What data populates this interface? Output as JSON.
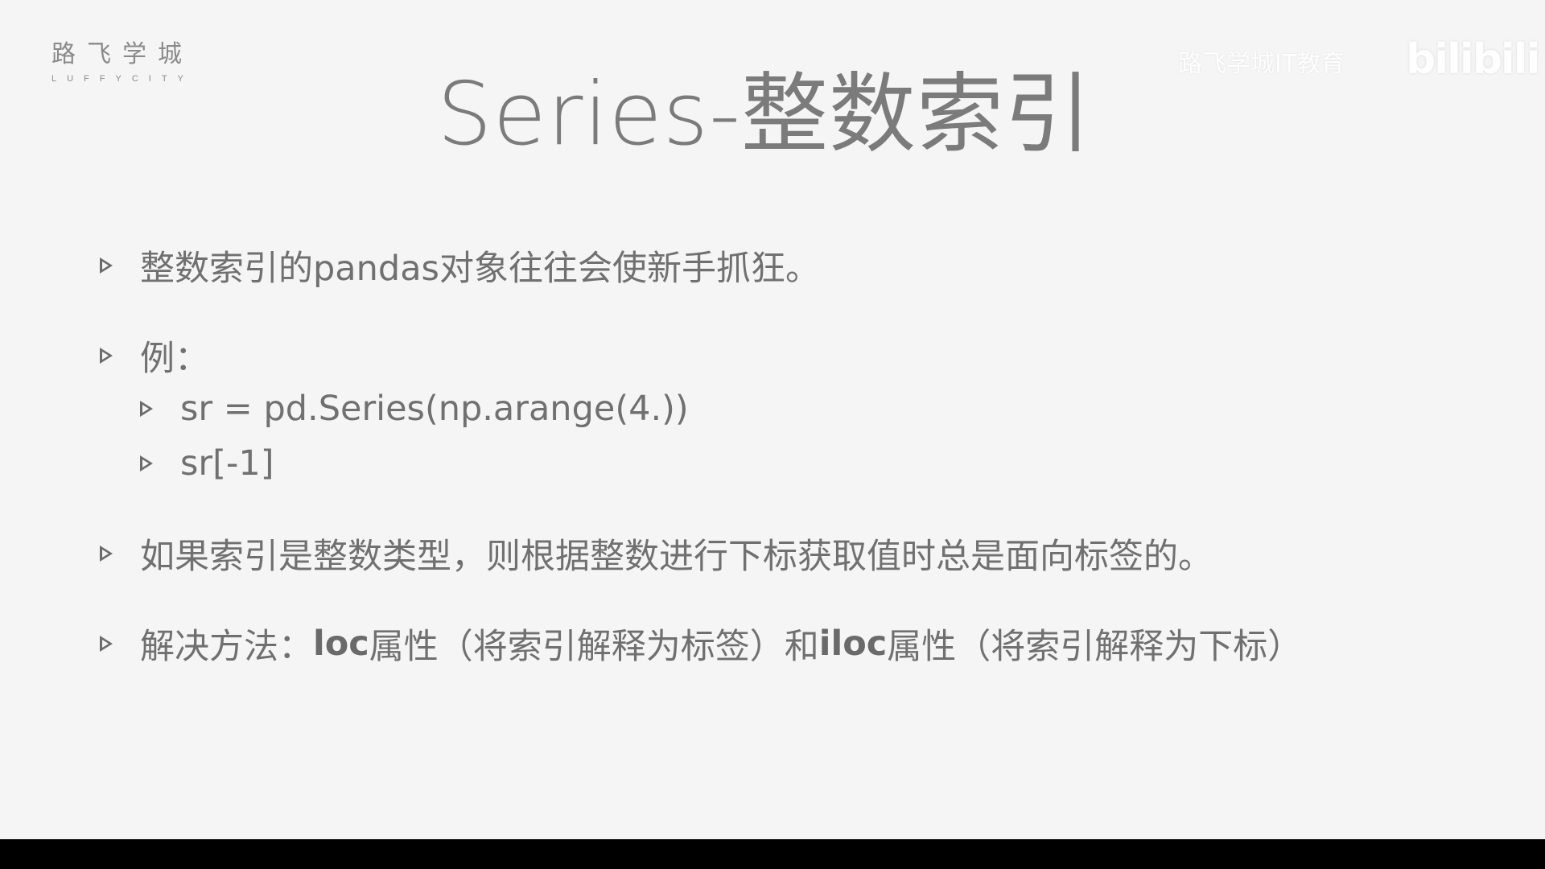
{
  "logo": {
    "name_cn": "路飞学城",
    "name_en": "LUFFYCITY"
  },
  "watermark": {
    "text": "路飞学城IT教育",
    "logo": "bilibili"
  },
  "title": "Series-整数索引",
  "bullets": {
    "b1": "整数索引的pandas对象往往会使新手抓狂。",
    "b2": "例：",
    "b2_sub1": "sr = pd.Series(np.arange(4.))",
    "b2_sub2": "sr[-1]",
    "b3": "如果索引是整数类型，则根据整数进行下标获取值时总是面向标签的。",
    "b4_prefix": "解决方法：",
    "b4_loc": "loc",
    "b4_loc_desc": "属性（将索引解释为标签）和",
    "b4_iloc": "iloc",
    "b4_iloc_desc": "属性（将索引解释为下标）"
  },
  "colors": {
    "background": "#f5f5f5",
    "text": "#707070",
    "title": "#7b7b7b",
    "bottom_bar": "#000000"
  }
}
